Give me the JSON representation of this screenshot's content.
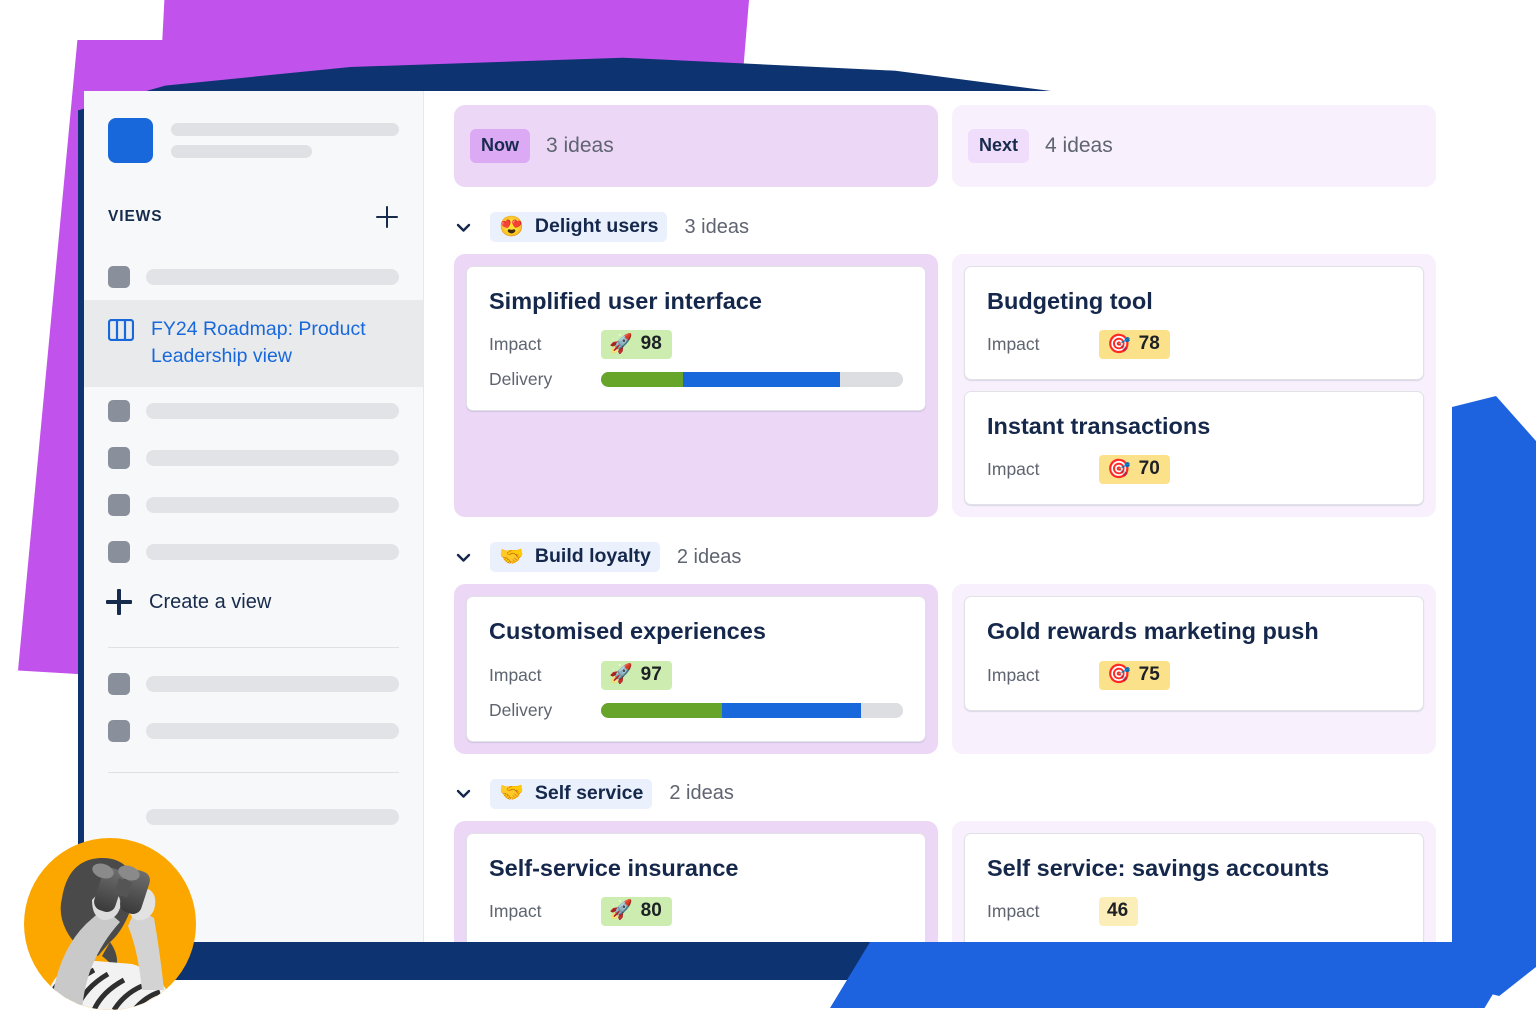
{
  "sidebar": {
    "section_label": "VIEWS",
    "add_view_icon": "plus-icon",
    "active_view": {
      "label": "FY24 Roadmap: Product Leadership view",
      "icon": "board-icon",
      "color": "#1868db"
    },
    "create_view_label": "Create a view",
    "skeleton_rows_upper": 1,
    "skeleton_rows_middle": 4,
    "skeleton_rows_lower": 2,
    "skeleton_rows_footer": 1
  },
  "board": {
    "columns": [
      {
        "chip": "Now",
        "count": "3 ideas",
        "chip_color": "#dca9f5",
        "bg_color": "#ecd7f7"
      },
      {
        "chip": "Next",
        "count": "4 ideas",
        "chip_color": "#f0dcfb",
        "bg_color": "#f8f0fd"
      }
    ],
    "groups": [
      {
        "emoji": "😍",
        "emoji_name": "smiling-face-with-hearts-icon",
        "name": "Delight users",
        "count": "3 ideas",
        "collapse_icon": "chevron-down-icon",
        "now_cards": [
          {
            "title": "Simplified user interface",
            "impact_label": "Impact",
            "impact_value": "98",
            "impact_emoji": "🚀",
            "impact_emoji_name": "rocket-icon",
            "impact_badge_color": "#cdedb0",
            "delivery_label": "Delivery",
            "delivery": {
              "green_pct": 27,
              "blue_pct": 52,
              "empty_pct": 21
            }
          }
        ],
        "next_cards": [
          {
            "title": "Budgeting tool",
            "impact_label": "Impact",
            "impact_value": "78",
            "impact_emoji": "🎯",
            "impact_emoji_name": "target-icon",
            "impact_badge_color": "#fbe18a"
          },
          {
            "title": "Instant transactions",
            "impact_label": "Impact",
            "impact_value": "70",
            "impact_emoji": "🎯",
            "impact_emoji_name": "target-icon",
            "impact_badge_color": "#fbe18a"
          }
        ]
      },
      {
        "emoji": "🤝",
        "emoji_name": "handshake-icon",
        "name": "Build loyalty",
        "count": "2 ideas",
        "collapse_icon": "chevron-down-icon",
        "now_cards": [
          {
            "title": "Customised experiences",
            "impact_label": "Impact",
            "impact_value": "97",
            "impact_emoji": "🚀",
            "impact_emoji_name": "rocket-icon",
            "impact_badge_color": "#cdedb0",
            "delivery_label": "Delivery",
            "delivery": {
              "green_pct": 40,
              "blue_pct": 46,
              "empty_pct": 14
            }
          }
        ],
        "next_cards": [
          {
            "title": "Gold rewards marketing push",
            "impact_label": "Impact",
            "impact_value": "75",
            "impact_emoji": "🎯",
            "impact_emoji_name": "target-icon",
            "impact_badge_color": "#fbe18a"
          }
        ]
      },
      {
        "emoji": "🤝",
        "emoji_name": "handshake-icon",
        "name": "Self service",
        "count": "2 ideas",
        "collapse_icon": "chevron-down-icon",
        "now_cards": [
          {
            "title": "Self-service insurance",
            "impact_label": "Impact",
            "impact_value": "80",
            "impact_emoji": "🚀",
            "impact_emoji_name": "rocket-icon",
            "impact_badge_color": "#cdedb0"
          }
        ],
        "next_cards": [
          {
            "title": "Self service: savings accounts",
            "impact_label": "Impact",
            "impact_value": "46",
            "impact_emoji": "",
            "impact_emoji_name": "none",
            "impact_badge_color": "#fceeb8"
          }
        ]
      }
    ]
  },
  "decoration": {
    "avatar_icon": "avatar-photo-binoculars",
    "avatar_bg": "#fba700",
    "purple": "#c152ec",
    "navy": "#0d3370",
    "blue": "#1d63e0"
  }
}
